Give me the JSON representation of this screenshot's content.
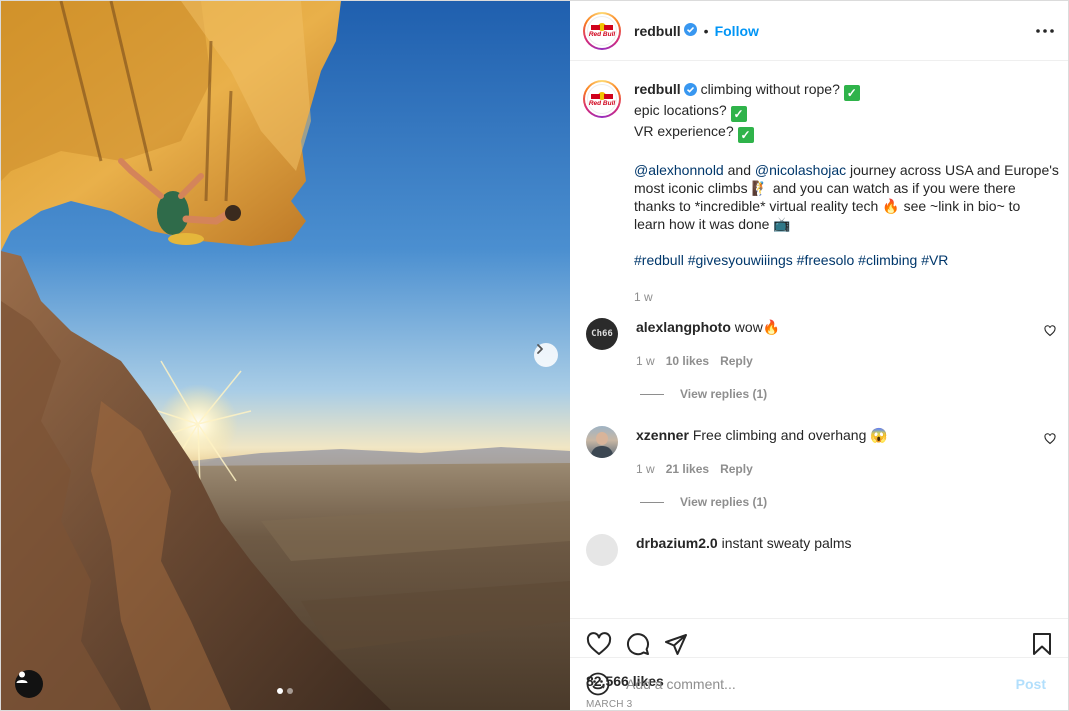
{
  "post": {
    "author": "redbull",
    "brand_logo_text": "Red Bull",
    "follow_label": "Follow",
    "separator": "•",
    "caption": {
      "lines": [
        "climbing without rope?",
        "epic locations?",
        "VR experience?",
        "",
        "journey across USA and Europe's",
        "most iconic climbs",
        "and you can watch as if you were there",
        "thanks to *incredible* virtual reality tech",
        "see ~link in bio~ to",
        "learn how it was done"
      ],
      "mentions": [
        "@alexhonnold",
        "@nicolashojac"
      ],
      "and_word": "and",
      "hashtags": [
        "#redbull",
        "#givesyouwiiings",
        "#freesolo",
        "#climbing",
        "#VR"
      ],
      "time": "1 w"
    },
    "comments": [
      {
        "username": "alexlangphoto",
        "text": "wow",
        "emoji": "🔥",
        "time": "1 w",
        "likes": "10 likes",
        "reply_label": "Reply",
        "view_replies": "View replies (1)",
        "avatar_text": "Ch66"
      },
      {
        "username": "xzenner",
        "text": "Free climbing and overhang",
        "emoji": "😱",
        "time": "1 w",
        "likes": "21 likes",
        "reply_label": "Reply",
        "view_replies": "View replies (1)"
      },
      {
        "username": "drbazium2.0",
        "text": "instant sweaty palms"
      }
    ],
    "likes": "82,566 likes",
    "date": "MARCH 3",
    "add_comment": {
      "placeholder": "Add a comment...",
      "post_label": "Post"
    },
    "carousel": {
      "total": 2,
      "active": 1
    }
  },
  "icons": {
    "verified": "verified-badge-icon",
    "more": "more-options-icon",
    "like": "heart-icon",
    "comment": "comment-bubble-icon",
    "share": "paper-plane-icon",
    "save": "bookmark-icon",
    "emoji": "smiley-icon",
    "next": "chevron-right-icon",
    "tag": "user-tag-icon"
  },
  "colors": {
    "accent": "#0095f6",
    "link": "#00376b",
    "muted": "#8e8e8e",
    "post_disabled": "#b2dffc",
    "check_emoji": "#2fb34a"
  }
}
